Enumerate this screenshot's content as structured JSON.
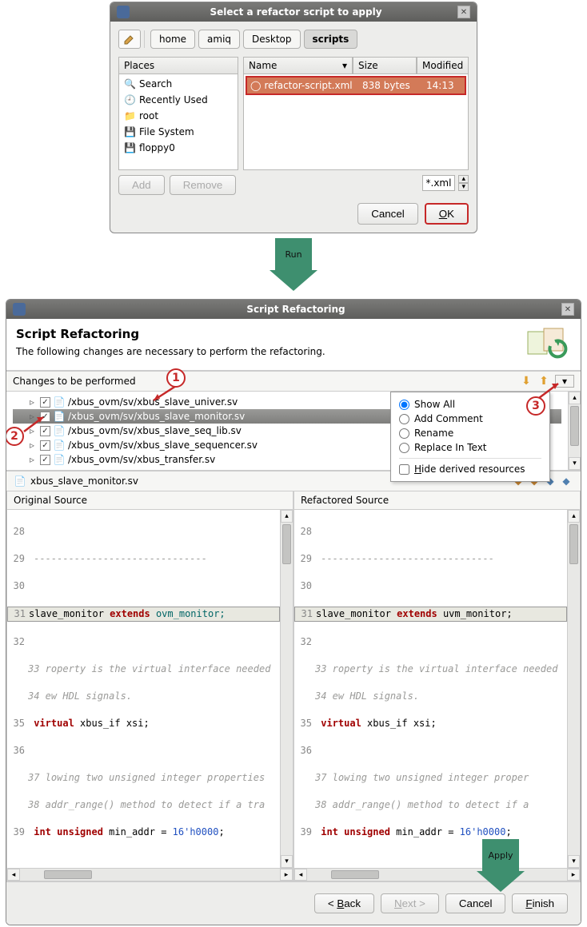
{
  "dialog1": {
    "title": "Select a refactor script to apply",
    "path": [
      "home",
      "amiq",
      "Desktop",
      "scripts"
    ],
    "places_header": "Places",
    "places": [
      "Search",
      "Recently Used",
      "root",
      "File System",
      "floppy0"
    ],
    "cols": {
      "name": "Name",
      "size": "Size",
      "modified": "Modified"
    },
    "file": {
      "name": "refactor-script.xml",
      "size": "838 bytes",
      "modified": "14:13"
    },
    "add": "Add",
    "remove": "Remove",
    "filter": "*.xml",
    "cancel": "Cancel",
    "ok": "OK"
  },
  "run_label": "Run",
  "dialog2": {
    "title": "Script Refactoring",
    "heading": "Script Refactoring",
    "subtitle": "The following changes are necessary to perform the refactoring.",
    "changes_label": "Changes to be performed",
    "tree": [
      "/xbus_ovm/sv/xbus_slave_univer.sv",
      "/xbus_ovm/sv/xbus_slave_monitor.sv",
      "/xbus_ovm/sv/xbus_slave_seq_lib.sv",
      "/xbus_ovm/sv/xbus_slave_sequencer.sv",
      "/xbus_ovm/sv/xbus_transfer.sv"
    ],
    "menu": {
      "show_all": "Show All",
      "add_comment": "Add Comment",
      "rename": "Rename",
      "replace": "Replace In Text",
      "hide": "Hide derived resources"
    },
    "tab": "xbus_slave_monitor.sv",
    "orig": "Original Source",
    "refa": "Refactored Source",
    "code_orig": {
      "l28": "28",
      "l29": "29 ------------------------------",
      "l30": "30",
      "l31_a": "slave_monitor ",
      "l31_b": "extends",
      "l31_c": " ovm_monitor;",
      "l32": "32",
      "l33": "33 roperty is the virtual interface needed",
      "l34": "34 ew HDL signals.",
      "l35_a": "virtual",
      "l35_b": " xbus_if xsi;",
      "l36": "36",
      "l37": "37 lowing two unsigned integer properties",
      "l38": "38 addr_range() method to detect if a tra",
      "l39_a": "int",
      "l39_b": "unsigned",
      "l39_c": " min_addr = ",
      "l39_d": "16'h0000",
      "l39_e": ";"
    },
    "code_refa": {
      "l31_a": "slave_monitor ",
      "l31_b": "extends",
      "l31_c": " uvm_monitor;",
      "l33": "33 roperty is the virtual interface needed",
      "l37": "37 lowing two unsigned integer proper",
      "l38": "38 addr_range() method to detect if a"
    },
    "back": "< Back",
    "next": "Next >",
    "cancel": "Cancel",
    "finish": "Finish"
  },
  "apply_label": "Apply",
  "callouts": {
    "c1": "1",
    "c2": "2",
    "c3": "3"
  }
}
